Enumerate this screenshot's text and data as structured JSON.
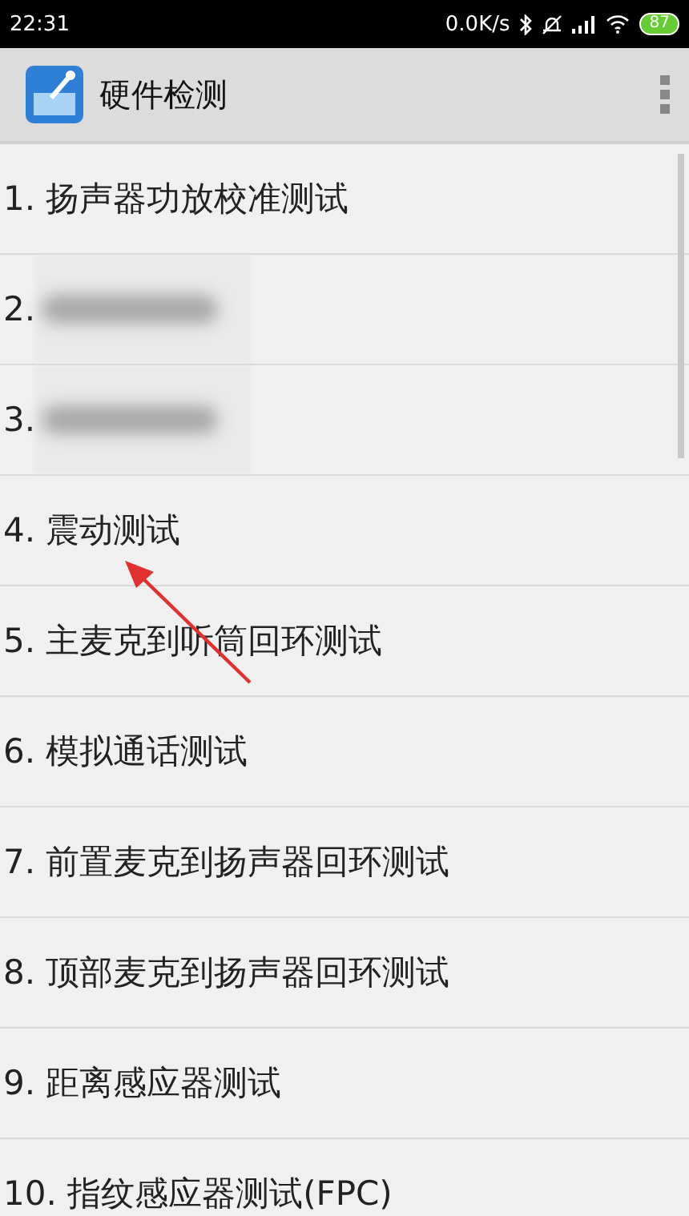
{
  "status_bar": {
    "time": "22:31",
    "speed": "0.0K/s",
    "battery": "87"
  },
  "app_bar": {
    "title": "硬件检测"
  },
  "items": [
    {
      "label": "1. 扬声器功放校准测试",
      "redacted": false
    },
    {
      "label": "2.",
      "redacted": true
    },
    {
      "label": "3.",
      "redacted": true
    },
    {
      "label": "4. 震动测试",
      "redacted": false
    },
    {
      "label": "5. 主麦克到听筒回环测试",
      "redacted": false
    },
    {
      "label": "6. 模拟通话测试",
      "redacted": false
    },
    {
      "label": "7. 前置麦克到扬声器回环测试",
      "redacted": false
    },
    {
      "label": "8. 顶部麦克到扬声器回环测试",
      "redacted": false
    },
    {
      "label": "9. 距离感应器测试",
      "redacted": false
    },
    {
      "label": "10. 指纹感应器测试(FPC)",
      "redacted": false
    }
  ]
}
